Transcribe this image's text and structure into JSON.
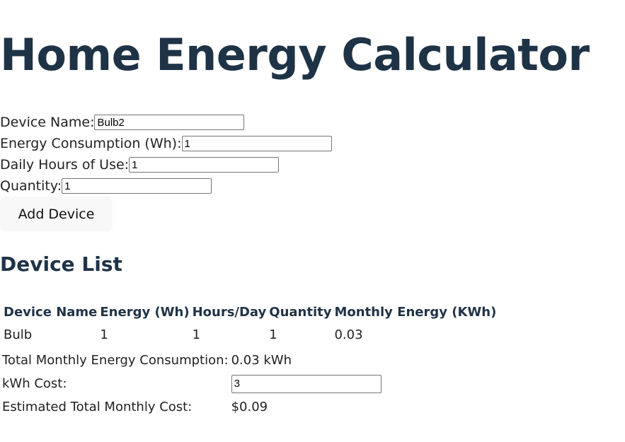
{
  "page": {
    "title": "Home Energy Calculator"
  },
  "form": {
    "device_name_label": "Device Name:",
    "device_name_value": "Bulb2",
    "energy_label": "Energy Consumption (Wh):",
    "energy_value": "1",
    "hours_label": "Daily Hours of Use:",
    "hours_value": "1",
    "quantity_label": "Quantity:",
    "quantity_value": "1",
    "add_button_label": "Add Device"
  },
  "device_list": {
    "heading": "Device List",
    "columns": [
      "Device Name",
      "Energy (Wh)",
      "Hours/Day",
      "Quantity",
      "Monthly Energy (KWh)"
    ],
    "rows": [
      [
        "Bulb",
        "1",
        "1",
        "1",
        "0.03"
      ]
    ]
  },
  "totals": {
    "total_label": "Total Monthly Energy Consumption:",
    "total_value": "0.03 kWh",
    "cost_label": "kWh Cost:",
    "cost_value": "3",
    "estimated_label": "Estimated Total Monthly Cost:",
    "estimated_value": "$0.09"
  },
  "colors": {
    "heading": "#1f3347",
    "button_bg": "#f8f8f8"
  }
}
